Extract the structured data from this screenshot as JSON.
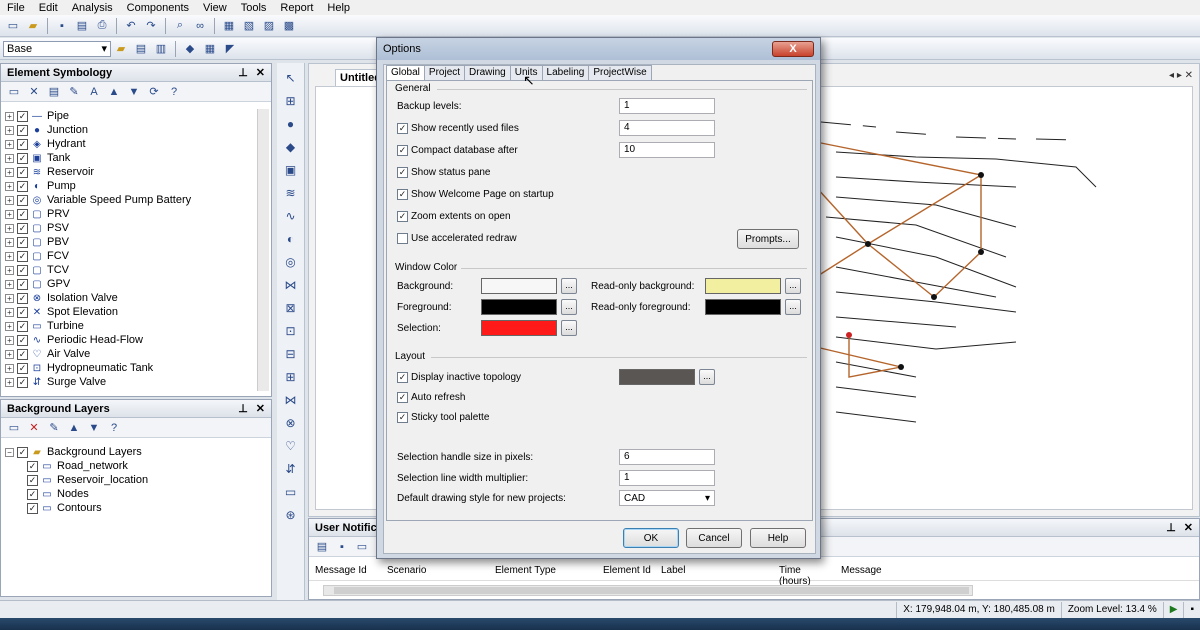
{
  "menu": [
    "File",
    "Edit",
    "Analysis",
    "Components",
    "View",
    "Tools",
    "Report",
    "Help"
  ],
  "toolbar2": {
    "base_selector": "Base"
  },
  "element_symbology": {
    "title": "Element Symbology",
    "items": [
      {
        "label": "Pipe",
        "icon": "pipe-icon",
        "glyph": "—"
      },
      {
        "label": "Junction",
        "icon": "junction-icon",
        "glyph": "●"
      },
      {
        "label": "Hydrant",
        "icon": "hydrant-icon",
        "glyph": "◈"
      },
      {
        "label": "Tank",
        "icon": "tank-icon",
        "glyph": "▣"
      },
      {
        "label": "Reservoir",
        "icon": "reservoir-icon",
        "glyph": "≋"
      },
      {
        "label": "Pump",
        "icon": "pump-icon",
        "glyph": "◐"
      },
      {
        "label": "Variable Speed Pump Battery",
        "icon": "vspb-icon",
        "glyph": "◎"
      },
      {
        "label": "PRV",
        "icon": "prv-icon",
        "glyph": "▢"
      },
      {
        "label": "PSV",
        "icon": "psv-icon",
        "glyph": "▢"
      },
      {
        "label": "PBV",
        "icon": "pbv-icon",
        "glyph": "▢"
      },
      {
        "label": "FCV",
        "icon": "fcv-icon",
        "glyph": "▢"
      },
      {
        "label": "TCV",
        "icon": "tcv-icon",
        "glyph": "▢"
      },
      {
        "label": "GPV",
        "icon": "gpv-icon",
        "glyph": "▢"
      },
      {
        "label": "Isolation Valve",
        "icon": "isolation-valve-icon",
        "glyph": "⊗"
      },
      {
        "label": "Spot Elevation",
        "icon": "spot-elevation-icon",
        "glyph": "✕"
      },
      {
        "label": "Turbine",
        "icon": "turbine-icon",
        "glyph": "▭"
      },
      {
        "label": "Periodic Head-Flow",
        "icon": "periodic-head-flow-icon",
        "glyph": "∿"
      },
      {
        "label": "Air Valve",
        "icon": "air-valve-icon",
        "glyph": "♡"
      },
      {
        "label": "Hydropneumatic Tank",
        "icon": "hydropneumatic-tank-icon",
        "glyph": "⊡"
      },
      {
        "label": "Surge Valve",
        "icon": "surge-valve-icon",
        "glyph": "⇵"
      }
    ]
  },
  "background_layers": {
    "title": "Background Layers",
    "root": "Background Layers",
    "items": [
      "Road_network",
      "Reservoir_location",
      "Nodes",
      "Contours"
    ]
  },
  "document_tab": "Untitled",
  "user_notifications": {
    "title": "User Notific",
    "columns": [
      "Message Id",
      "Scenario",
      "Element Type",
      "Element Id",
      "Label",
      "Time (hours)",
      "Message"
    ]
  },
  "status": {
    "coords": "X: 179,948.04 m, Y: 180,485.08 m",
    "zoom": "Zoom Level: 13.4 %"
  },
  "dialog": {
    "title": "Options",
    "close": "X",
    "tabs": [
      "Global",
      "Project",
      "Drawing",
      "Units",
      "Labeling",
      "ProjectWise"
    ],
    "active_tab": "Global",
    "general": {
      "heading": "General",
      "backup_levels_label": "Backup levels:",
      "backup_levels": "1",
      "recent_files_label": "Show recently used files",
      "recent_files": "4",
      "compact_label": "Compact database after",
      "compact": "10",
      "status_pane_label": "Show status pane",
      "welcome_label": "Show Welcome Page on startup",
      "zoom_extents_label": "Zoom extents on open",
      "accelerated_label": "Use accelerated redraw",
      "prompts_button": "Prompts..."
    },
    "window_color": {
      "heading": "Window Color",
      "background_label": "Background:",
      "foreground_label": "Foreground:",
      "selection_label": "Selection:",
      "ro_background_label": "Read-only background:",
      "ro_foreground_label": "Read-only foreground:",
      "background_color": "#f7f7f7",
      "foreground_color": "#000000",
      "selection_color": "#ff1a1a",
      "ro_background_color": "#f2f0a0",
      "ro_foreground_color": "#000000",
      "ellipsis": "..."
    },
    "layout": {
      "heading": "Layout",
      "inactive_topology_label": "Display inactive topology",
      "inactive_color": "#5a5654",
      "auto_refresh_label": "Auto refresh",
      "sticky_palette_label": "Sticky tool palette",
      "handle_size_label": "Selection handle size in pixels:",
      "handle_size": "6",
      "line_width_label": "Selection line width multiplier:",
      "line_width": "1",
      "drawing_style_label": "Default drawing style for new projects:",
      "drawing_style": "CAD"
    },
    "buttons": {
      "ok": "OK",
      "cancel": "Cancel",
      "help": "Help"
    }
  }
}
